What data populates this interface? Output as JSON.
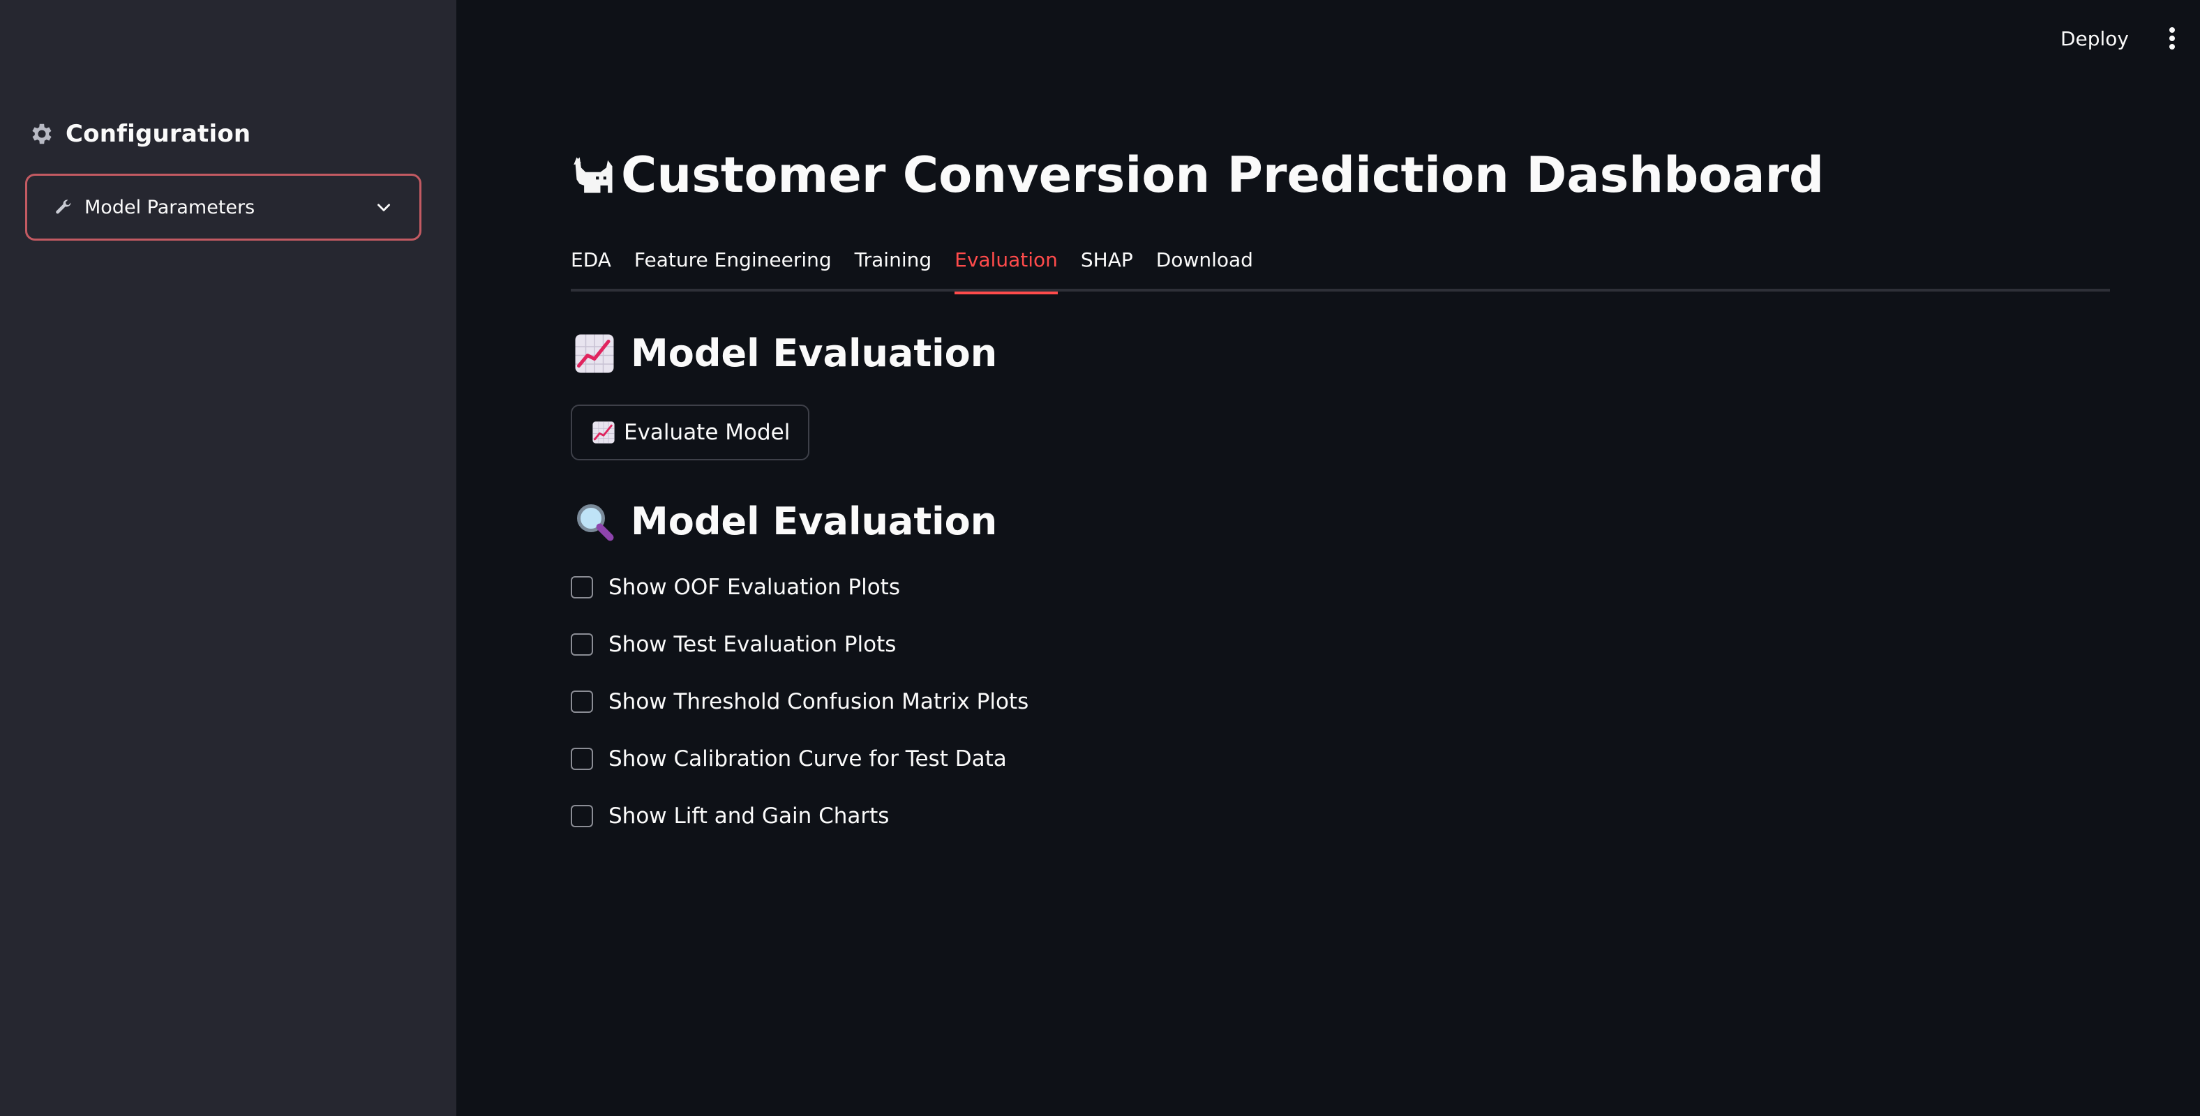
{
  "sidebar": {
    "title": "Configuration",
    "icon": "gear-icon",
    "expander": {
      "label": "Model Parameters",
      "icon": "wrench-icon",
      "expanded": false
    }
  },
  "header": {
    "deploy_label": "Deploy",
    "menu_icon": "kebab-menu-icon"
  },
  "main": {
    "title": "Customer Conversion Prediction Dashboard",
    "title_icon": "cat-icon",
    "tabs": [
      {
        "label": "EDA",
        "active": false
      },
      {
        "label": "Feature Engineering",
        "active": false
      },
      {
        "label": "Training",
        "active": false
      },
      {
        "label": "Evaluation",
        "active": true
      },
      {
        "label": "SHAP",
        "active": false
      },
      {
        "label": "Download",
        "active": false
      }
    ],
    "section1": {
      "heading": "Model Evaluation",
      "icon": "chart-increasing-icon",
      "button_label": "Evaluate Model",
      "button_icon": "chart-increasing-icon"
    },
    "section2": {
      "heading": "Model Evaluation",
      "icon": "magnifier-icon",
      "checkboxes": [
        {
          "label": "Show OOF Evaluation Plots",
          "checked": false
        },
        {
          "label": "Show Test Evaluation Plots",
          "checked": false
        },
        {
          "label": "Show Threshold Confusion Matrix Plots",
          "checked": false
        },
        {
          "label": "Show Calibration Curve for Test Data",
          "checked": false
        },
        {
          "label": "Show Lift and Gain Charts",
          "checked": false
        }
      ]
    }
  },
  "colors": {
    "background": "#0e1117",
    "sidebar": "#262730",
    "accent": "#ff4b4b",
    "text": "#fafafa"
  }
}
